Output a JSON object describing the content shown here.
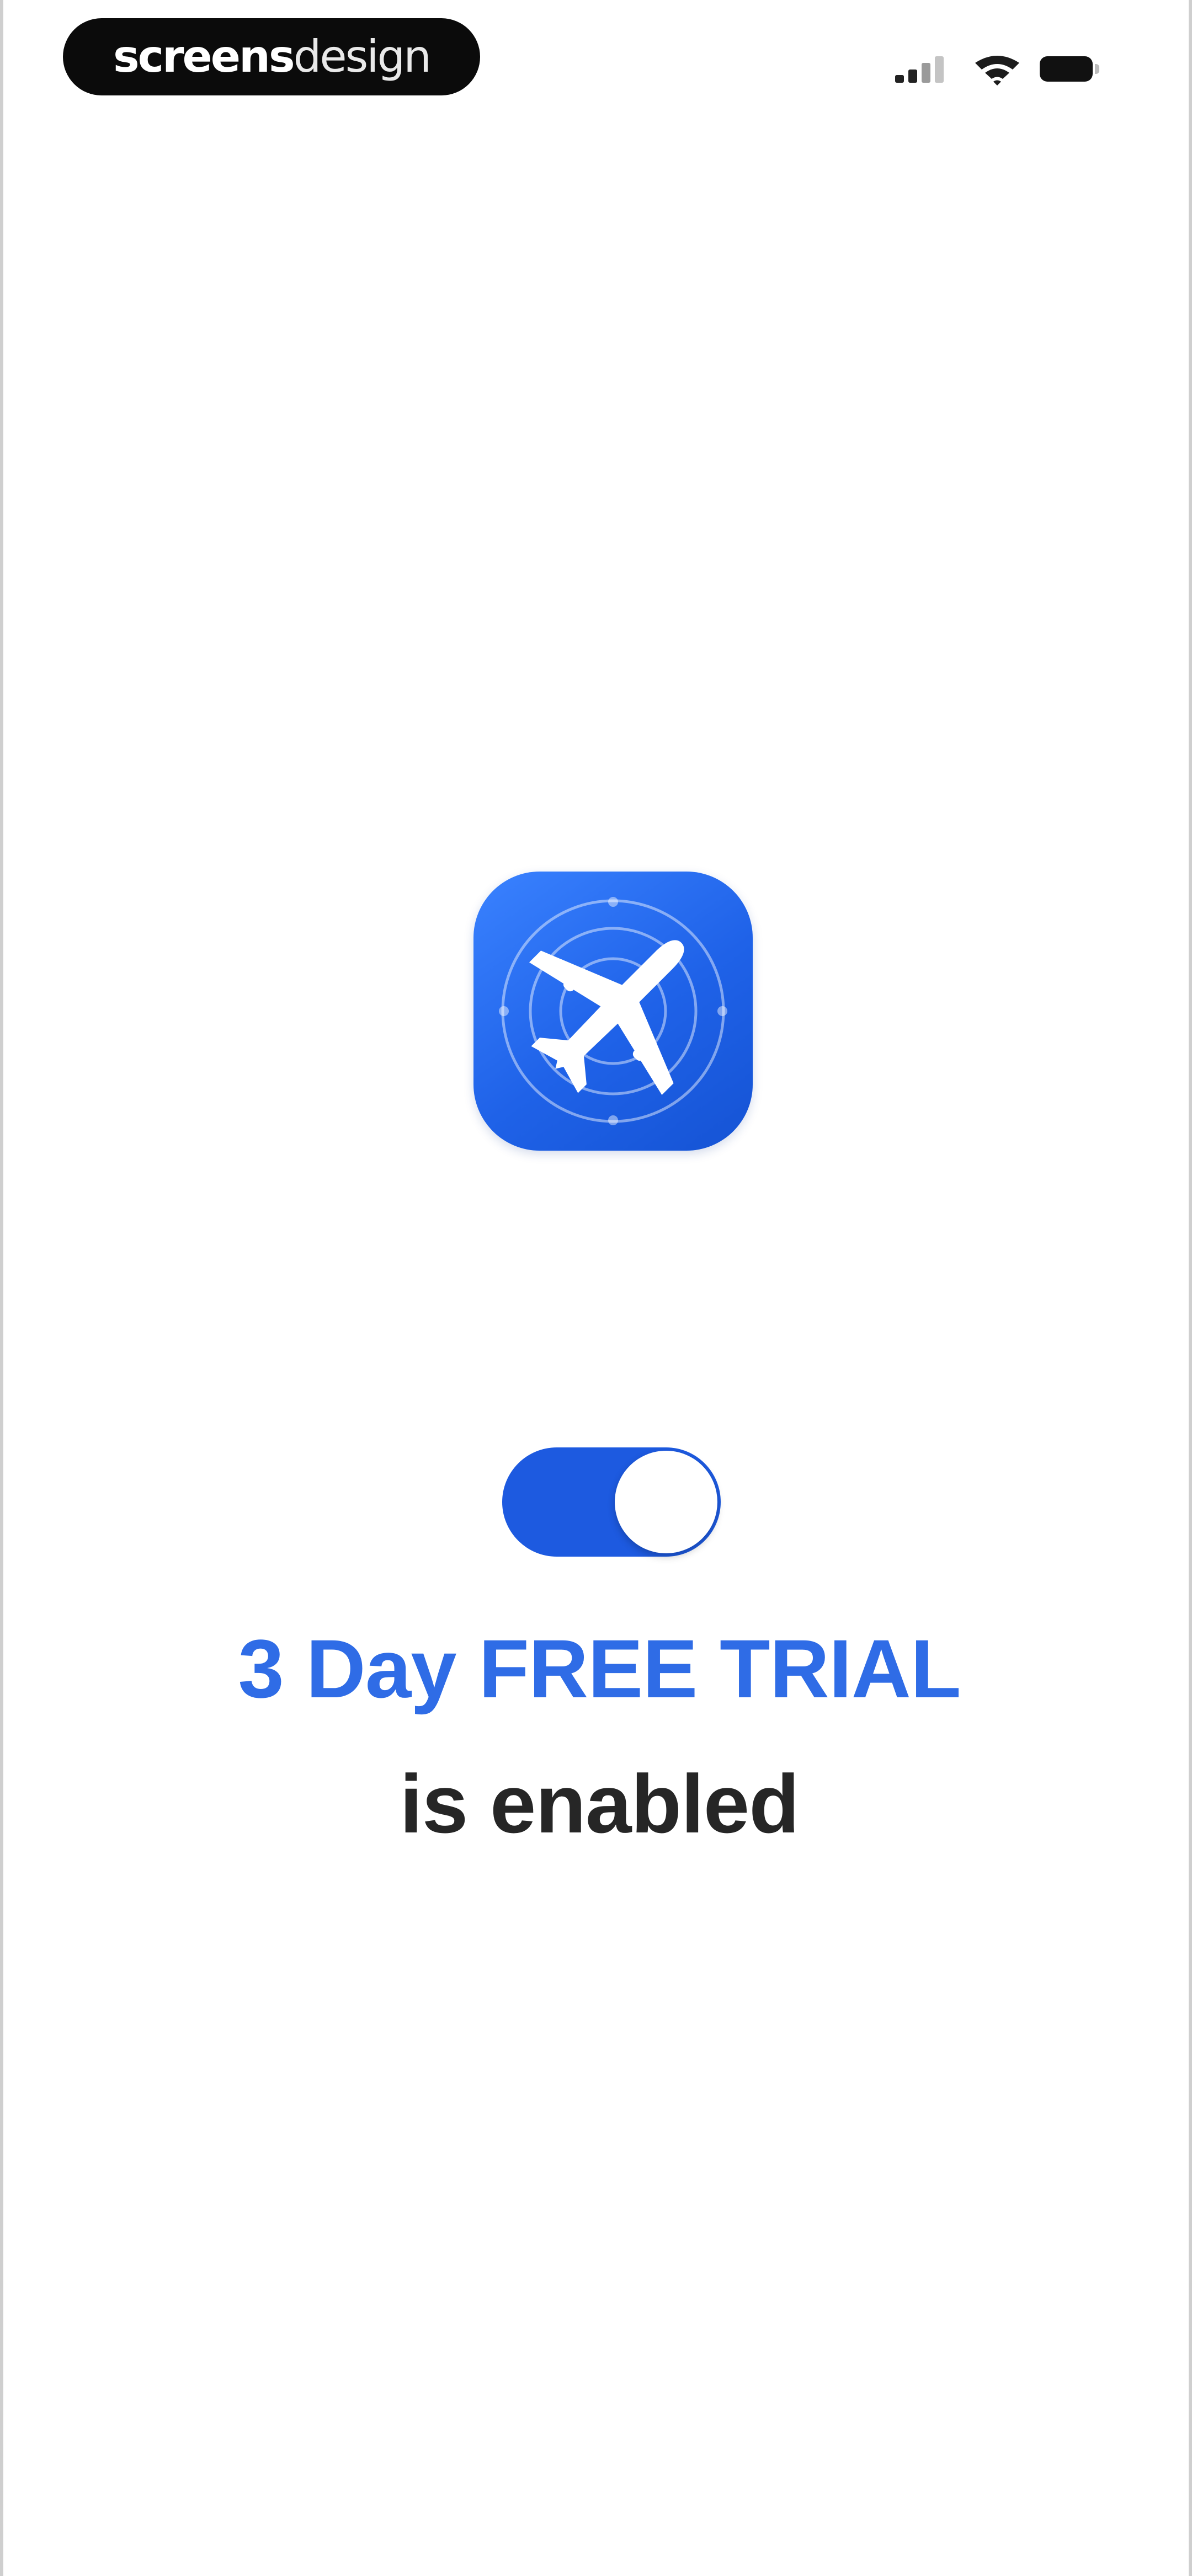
{
  "status_bar": {
    "watermark_bold": "screens",
    "watermark_thin": "design",
    "icons": [
      "cellular-signal-icon",
      "wifi-icon",
      "battery-icon"
    ]
  },
  "app_icon": {
    "icon": "airplane-radar-icon",
    "gradient_colors": [
      "#3a82ff",
      "#1553d4"
    ]
  },
  "toggle": {
    "state": "on",
    "on_color": "#1d5ae0"
  },
  "trial": {
    "heading": "3 Day FREE TRIAL",
    "subheading": "is enabled",
    "heading_color": "#2f6ce6",
    "subheading_color": "#262626"
  }
}
